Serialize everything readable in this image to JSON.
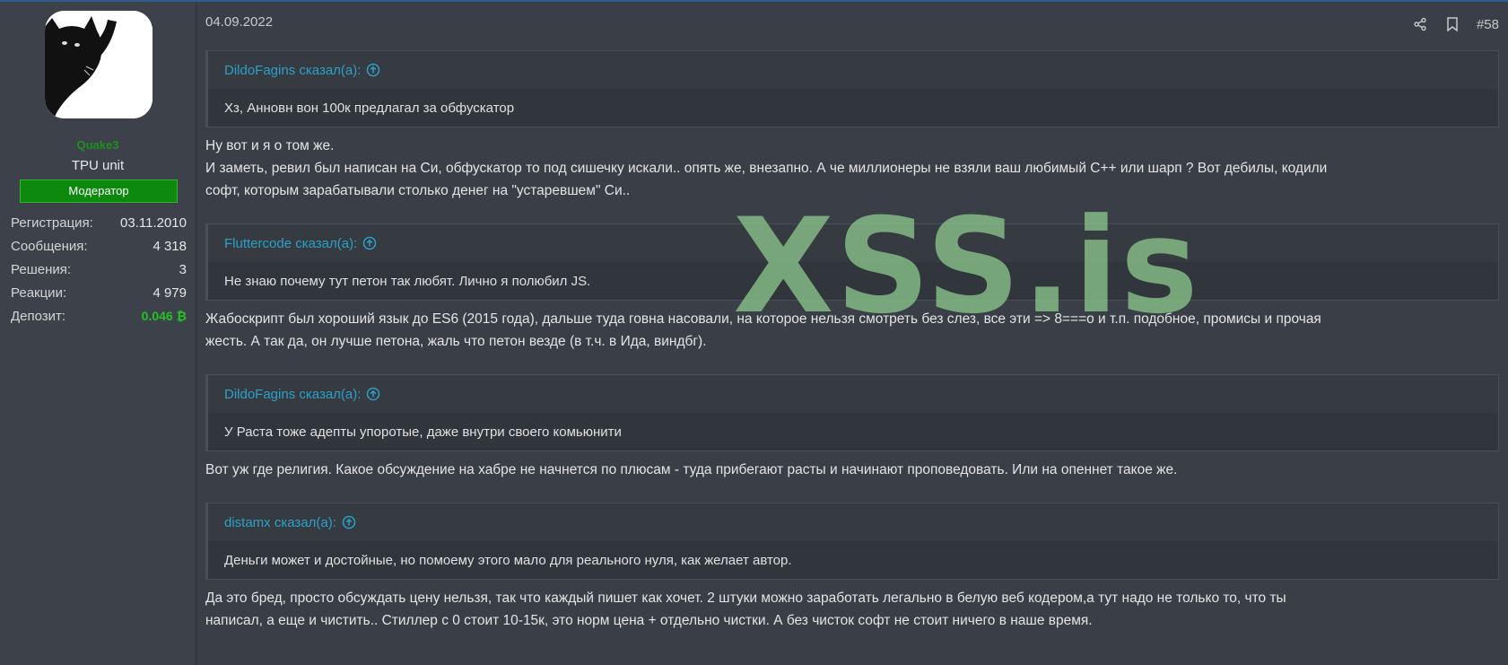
{
  "user": {
    "username": "Quake3",
    "title": "TPU unit",
    "role": "Модератор",
    "avatar_icon": "black-cat-avatar",
    "stats": [
      {
        "label": "Регистрация:",
        "value": "03.11.2010"
      },
      {
        "label": "Сообщения:",
        "value": "4 318"
      },
      {
        "label": "Решения:",
        "value": "3"
      },
      {
        "label": "Реакции:",
        "value": "4 979"
      },
      {
        "label": "Депозит:",
        "value": "0.046 ₿"
      }
    ]
  },
  "post": {
    "date": "04.09.2022",
    "number": "#58",
    "quotes": [
      {
        "author": "DildoFagins сказал(а):",
        "text": "Хз, Анновн вон 100к предлагал за обфускатор"
      },
      {
        "author": "Fluttercode сказал(а):",
        "text": "Не знаю почему тут петон так любят. Лично я полюбил JS."
      },
      {
        "author": "DildoFagins сказал(а):",
        "text": "У Раста тоже адепты упоротые, даже внутри своего комьюнити"
      },
      {
        "author": "distamx сказал(а):",
        "text": "Деньги может и достойные, но помоему этого мало для реального нуля, как желает автор."
      }
    ],
    "replies": [
      {
        "line1": "Ну вот и я о том же.",
        "line2": "И заметь, ревил был написан на Си, обфускатор то под сишечку искали.. опять же, внезапно. А че миллионеры не взяли ваш любимый С++ или шарп ? Вот дебилы, кодили",
        "line3": "софт, которым зарабатывали столько денег на \"устаревшем\" Си.."
      },
      {
        "line1": "Жабоскрипт был хороший язык до ES6 (2015 года), дальше туда говна насовали, на которое нельзя смотреть без слез, все эти => 8===o и т.п. подобное, промисы и прочая",
        "line2": "жесть. А так да, он лучше петона, жаль что петон везде (в т.ч. в Ида, виндбг)."
      },
      {
        "line1": "Вот уж где религия. Какое обсуждение на хабре не начнется по плюсам - туда прибегают расты и начинают проповедовать. Или на опеннет такое же."
      },
      {
        "line1": "Да это бред, просто обсуждать цену нельзя, так что каждый пишет как хочет. 2 штуки можно заработать легально в белую веб кодером,а тут надо не только то, что ты",
        "line2": "написал, а еще и чистить.. Стиллер с 0 стоит 10-15к, это норм цена + отдельно чистки. А без чисток софт не стоит ничего в наше время."
      }
    ]
  },
  "watermark": "XSS.is",
  "colors": {
    "background": "#3a3f47",
    "quote_link": "#2ba0c9",
    "role_badge": "#0d8a0d",
    "deposit": "#22c322"
  }
}
